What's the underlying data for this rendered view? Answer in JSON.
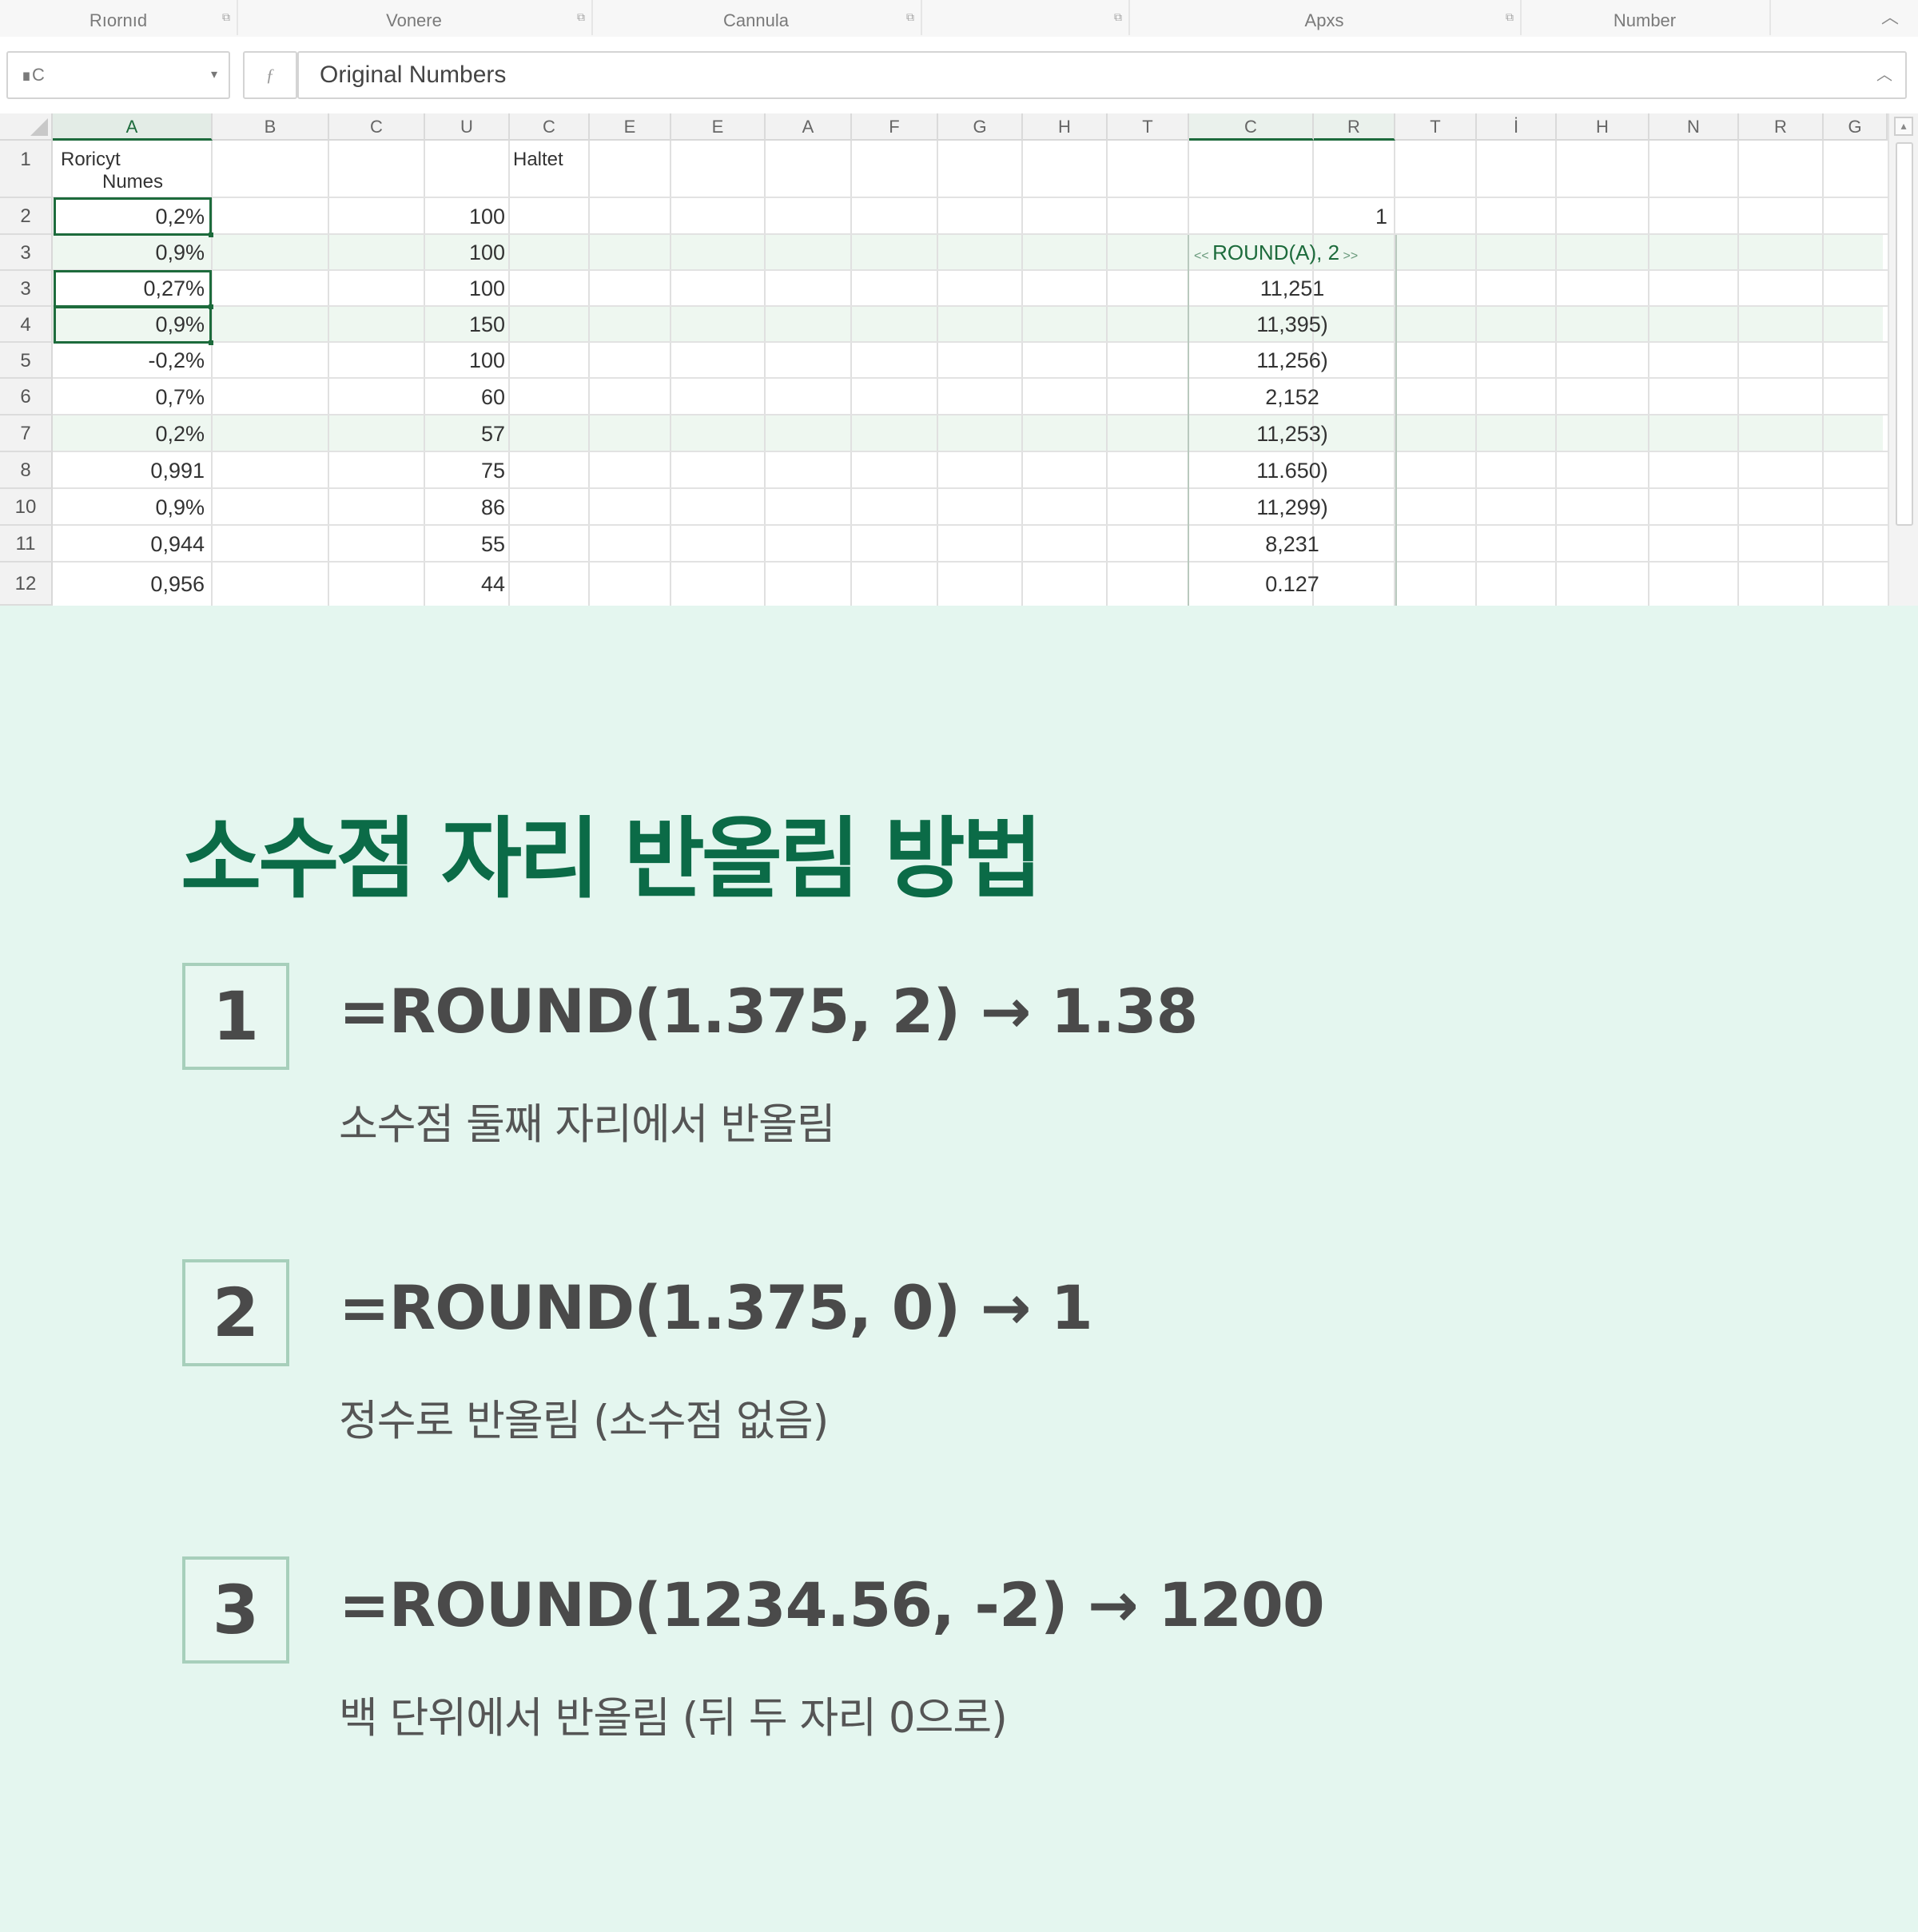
{
  "ribbon": {
    "groups": [
      {
        "label": "Rıornıd",
        "launcher": "⧉"
      },
      {
        "label": "Vonere",
        "launcher": "⧉"
      },
      {
        "label": "Cannula",
        "launcher": "⧉"
      },
      {
        "label": "",
        "launcher": "⧉"
      },
      {
        "label": "Apxs",
        "launcher": "⧉"
      },
      {
        "label": "Number",
        "launcher": ""
      }
    ],
    "collapse_icon": "chevron-up-icon"
  },
  "formula_bar": {
    "name_box": "∎C",
    "fx": "ƒ",
    "formula": "Original Numbers"
  },
  "grid": {
    "columns": [
      "A",
      "B",
      "C",
      "U",
      "C",
      "E",
      "E",
      "A",
      "F",
      "G",
      "H",
      "T",
      "C",
      "R",
      "T",
      "İ",
      "H",
      "N",
      "R",
      "G"
    ],
    "row_labels": [
      "1",
      "2",
      "3",
      "3",
      "4",
      "5",
      "6",
      "7",
      "8",
      "10",
      "11",
      "12"
    ],
    "header_cells": {
      "a1_line1": "Roricyt",
      "a1_line2": "Numes",
      "e1": "Haltet"
    },
    "r2_marker": "1",
    "formula_label": "ROUND(A), 2",
    "formula_arrows_left": "<<",
    "formula_arrows_right": ">>",
    "col_a": [
      "0,2%",
      "0,9%",
      "0,27%",
      "0,9%",
      "-0,2%",
      "0,7%",
      "0,2%",
      "0,991",
      "0,9%",
      "0,944",
      "0,956"
    ],
    "col_d": [
      "100",
      "100",
      "100",
      "150",
      "100",
      "60",
      "57",
      "75",
      "86",
      "55",
      "44"
    ],
    "col_result": [
      "11,251",
      "11,395)",
      "11,256)",
      "2,152",
      "11,253)",
      "11.650)",
      "11,299)",
      "8,231",
      "0.127"
    ]
  },
  "info": {
    "title": "소수점 자리 반올림 방법",
    "steps": [
      {
        "number": "1",
        "formula": "=ROUND(1.375, 2) → 1.38",
        "desc": "소수점 둘째 자리에서 반올림"
      },
      {
        "number": "2",
        "formula": "=ROUND(1.375, 0) → 1",
        "desc": "정수로 반올림 (소수점 없음)"
      },
      {
        "number": "3",
        "formula": "=ROUND(1234.56, -2) → 1200",
        "desc": "백 단위에서 반올림 (뒤 두 자리 0으로)"
      }
    ]
  },
  "colors": {
    "accent": "#0b6b47",
    "sheet_green": "#1d6b3c",
    "panel_bg": "#e4f6ef"
  }
}
